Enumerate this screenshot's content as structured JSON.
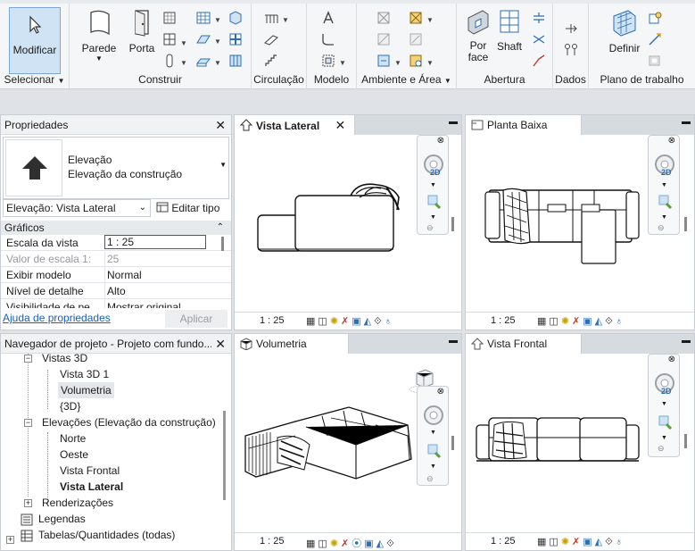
{
  "ribbon": {
    "groups": [
      {
        "label": "Selecionar",
        "buttons": [
          {
            "label": "Modificar"
          }
        ]
      },
      {
        "label": "Construir",
        "buttons": [
          {
            "label": "Parede"
          },
          {
            "label": "Porta"
          }
        ]
      },
      {
        "label": "Circulação"
      },
      {
        "label": "Modelo"
      },
      {
        "label": "Ambiente e Área"
      },
      {
        "label": "Abertura",
        "buttons": [
          {
            "label": "Por face"
          },
          {
            "label": "Shaft"
          }
        ]
      },
      {
        "label": "Dados"
      },
      {
        "label": "Plano de trabalho",
        "buttons": [
          {
            "label": "Definir"
          }
        ]
      }
    ]
  },
  "properties": {
    "title": "Propriedades",
    "type_line1": "Elevação",
    "type_line2": "Elevação da construção",
    "selector": "Elevação: Vista Lateral",
    "edit_type": "Editar tipo",
    "section": "Gráficos",
    "rows": [
      {
        "name": "Escala da vista",
        "value": "1 : 25"
      },
      {
        "name": "Valor de escala    1:",
        "value": "25"
      },
      {
        "name": "Exibir modelo",
        "value": "Normal"
      },
      {
        "name": "Nível de detalhe",
        "value": "Alto"
      },
      {
        "name": "Visibilidade de pe",
        "value": "Mostrar original"
      }
    ],
    "help_link": "Ajuda de propriedades",
    "apply": "Aplicar"
  },
  "browser": {
    "title": "Navegador de projeto - Projeto com fundo...",
    "nodes": [
      {
        "label": "Vistas 3D"
      },
      {
        "label": "Vista 3D 1"
      },
      {
        "label": "Volumetria"
      },
      {
        "label": "{3D}"
      },
      {
        "label": "Elevações (Elevação da construção)"
      },
      {
        "label": "Norte"
      },
      {
        "label": "Oeste"
      },
      {
        "label": "Vista Frontal"
      },
      {
        "label": "Vista Lateral"
      },
      {
        "label": "Renderizações"
      },
      {
        "label": "Legendas"
      },
      {
        "label": "Tabelas/Quantidades (todas)"
      }
    ]
  },
  "views": {
    "lateral": {
      "title": "Vista Lateral",
      "scale": "1 : 25",
      "nav_label": "2D"
    },
    "planta": {
      "title": "Planta Baixa",
      "scale": "1 : 25",
      "nav_label": "2D"
    },
    "volumetria": {
      "title": "Volumetria",
      "scale": "1 : 25"
    },
    "frontal": {
      "title": "Vista Frontal",
      "scale": "1 : 25",
      "nav_label": "2D"
    }
  }
}
